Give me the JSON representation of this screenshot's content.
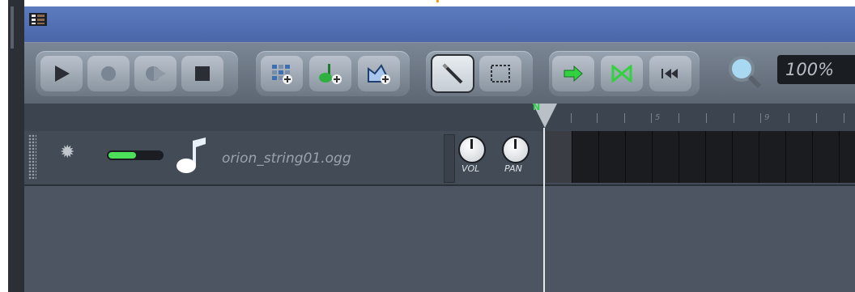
{
  "window": {
    "title": ""
  },
  "toolbar": {
    "transport": [
      "play-icon",
      "record-icon",
      "record-play-icon",
      "stop-icon"
    ],
    "add_buttons": [
      "add-beat-pattern-icon",
      "add-sample-track-icon",
      "add-automation-track-icon"
    ],
    "edit_modes": [
      "draw-mode-icon",
      "select-mode-icon"
    ],
    "playback": [
      "continue-playback-icon",
      "loop-icon",
      "rewind-to-start-icon"
    ],
    "zoom_value": "100%"
  },
  "ruler": {
    "numbers": [
      "5",
      "9"
    ]
  },
  "track": {
    "name": "orion_string01.ogg",
    "vol_label": "VOL",
    "pan_label": "PAN",
    "muted": false
  },
  "colors": {
    "accent_green": "#4de05a",
    "titlebar": "#5472b4"
  }
}
